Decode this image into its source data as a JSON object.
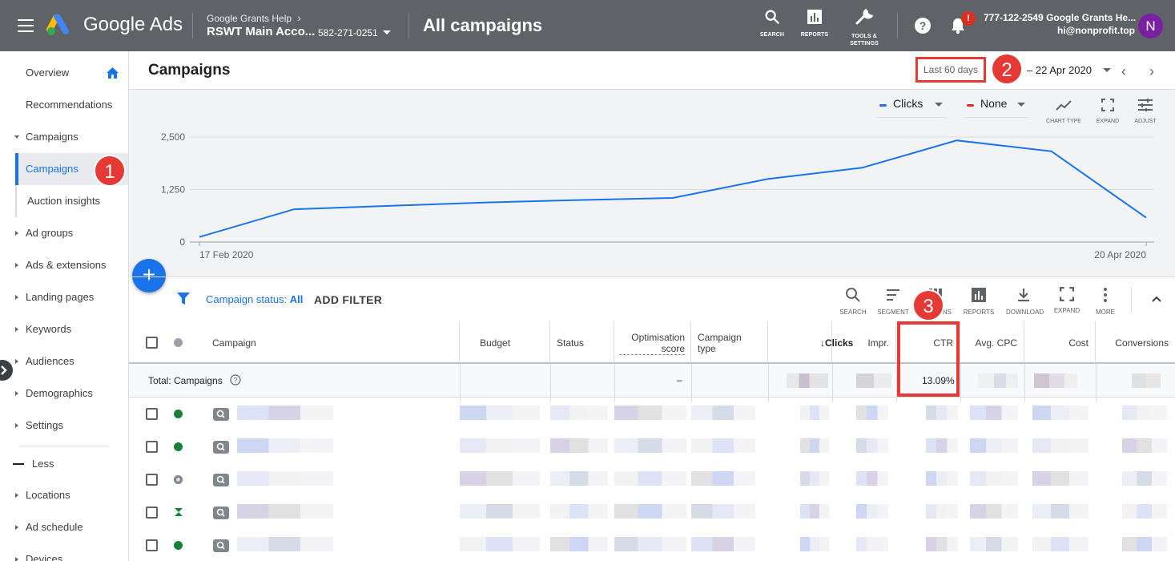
{
  "app": {
    "brand": "Google Ads",
    "breadcrumb_top": "Google Grants Help",
    "account_name": "RSWT Main Acco...",
    "account_id": "582-271-0251",
    "page_heading": "All campaigns",
    "tools": [
      {
        "label": "SEARCH",
        "icon": "search-icon"
      },
      {
        "label": "REPORTS",
        "icon": "reports-icon"
      },
      {
        "label": "TOOLS &",
        "label2": "SETTINGS",
        "icon": "wrench-icon"
      }
    ],
    "notification_badge": "!",
    "user_phone": "777-122-2549 Google Grants He...",
    "user_email": "hi@nonprofit.top",
    "avatar_initial": "N",
    "brand_colors": {
      "topbar": "#5f6368",
      "accent": "#1a73e8",
      "callout": "#e53935",
      "avatar": "#7b1fa2"
    }
  },
  "nav": {
    "items": [
      {
        "label": "Overview"
      },
      {
        "label": "Recommendations"
      },
      {
        "label": "Campaigns"
      },
      {
        "label": "Campaigns"
      },
      {
        "label": "Auction insights"
      },
      {
        "label": "Ad groups"
      },
      {
        "label": "Ads & extensions"
      },
      {
        "label": "Landing pages"
      },
      {
        "label": "Keywords"
      },
      {
        "label": "Audiences"
      },
      {
        "label": "Demographics"
      },
      {
        "label": "Settings"
      },
      {
        "label": "Less"
      },
      {
        "label": "Locations"
      },
      {
        "label": "Ad schedule"
      },
      {
        "label": "Devices"
      }
    ]
  },
  "page": {
    "title": "Campaigns",
    "date_preset": "Last 60 days",
    "date_range": "– 22 Apr 2020"
  },
  "chart_controls": {
    "metric1": "Clicks",
    "metric1_color": "#1a73e8",
    "metric2": "None",
    "metric2_color": "#d93025",
    "tools": [
      "CHART TYPE",
      "EXPAND",
      "ADJUST"
    ]
  },
  "chart_data": {
    "type": "line",
    "title": "",
    "xlabel": "",
    "ylabel": "",
    "x_tick_labels": [
      "17 Feb 2020",
      "20 Apr 2020"
    ],
    "y_tick_labels": [
      "2,500",
      "1,250",
      "0"
    ],
    "ylim": [
      0,
      2500
    ],
    "grid": true,
    "series": [
      {
        "values": [
          120,
          780,
          860,
          940,
          1000,
          1050,
          1500,
          1770,
          2420,
          2160,
          580
        ]
      }
    ]
  },
  "filters": {
    "status_label": "Campaign status:",
    "status_value": "All",
    "add_filter": "ADD FILTER"
  },
  "table_tools": [
    "SEARCH",
    "SEGMENT",
    "COLUMNS",
    "REPORTS",
    "DOWNLOAD",
    "EXPAND",
    "MORE"
  ],
  "table": {
    "columns": [
      "Campaign",
      "Budget",
      "Status",
      "Optimisation score",
      "Campaign type",
      "Clicks",
      "Impr.",
      "CTR",
      "Avg. CPC",
      "Cost",
      "Conversions"
    ],
    "total_label": "Total: Campaigns",
    "total_opt_score": "–",
    "total_ctr": "13.09%",
    "rows": [
      {
        "status": "eligible",
        "status_color": "#188038"
      },
      {
        "status": "eligible",
        "status_color": "#188038"
      },
      {
        "status": "paused",
        "status_color": "#80868b"
      },
      {
        "status": "limited",
        "status_color": "#188038"
      },
      {
        "status": "eligible",
        "status_color": "#188038"
      }
    ]
  },
  "callouts": [
    "1",
    "2",
    "3"
  ]
}
